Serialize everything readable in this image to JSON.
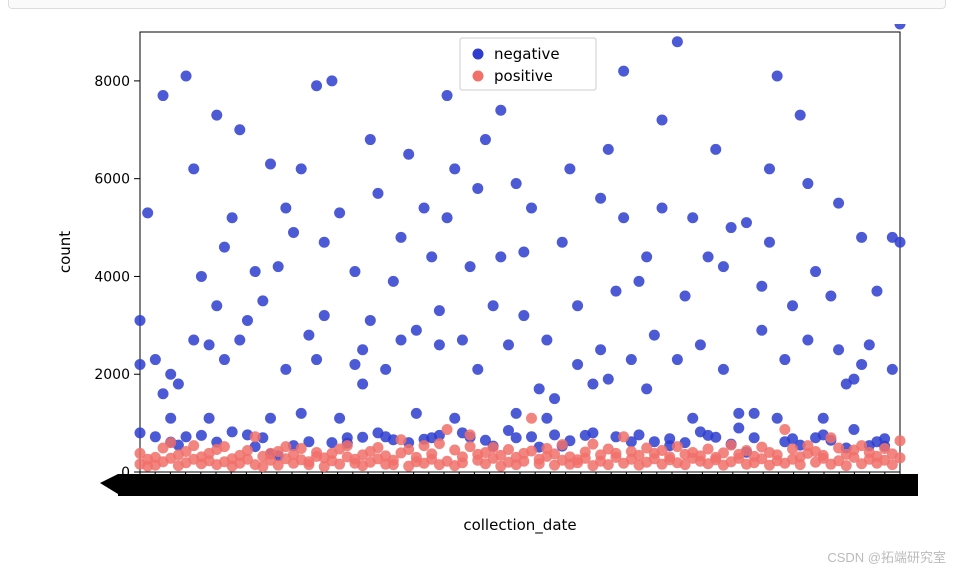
{
  "chart_data": {
    "type": "scatter",
    "title": "",
    "xlabel": "collection_date",
    "ylabel": "count",
    "ylim": [
      0,
      9000
    ],
    "yticks": [
      0,
      2000,
      4000,
      6000,
      8000
    ],
    "legend": [
      "negative",
      "positive"
    ],
    "legend_position": "upper center",
    "series": [
      {
        "name": "negative",
        "color": "#2e3dcf",
        "x": [
          1,
          1,
          1,
          2,
          2,
          3,
          3,
          4,
          4,
          5,
          5,
          5,
          6,
          6,
          7,
          7,
          8,
          8,
          9,
          9,
          10,
          10,
          11,
          11,
          11,
          12,
          12,
          13,
          13,
          14,
          14,
          15,
          15,
          16,
          16,
          17,
          17,
          18,
          18,
          18,
          19,
          19,
          20,
          20,
          21,
          21,
          22,
          22,
          23,
          23,
          24,
          24,
          25,
          25,
          26,
          26,
          27,
          27,
          28,
          28,
          29,
          29,
          30,
          30,
          30,
          31,
          31,
          32,
          32,
          33,
          33,
          34,
          34,
          35,
          35,
          36,
          36,
          37,
          37,
          38,
          38,
          39,
          39,
          40,
          40,
          40,
          41,
          41,
          42,
          42,
          43,
          43,
          44,
          44,
          45,
          45,
          46,
          46,
          47,
          47,
          48,
          48,
          49,
          49,
          50,
          50,
          50,
          51,
          51,
          52,
          52,
          53,
          53,
          54,
          54,
          55,
          55,
          56,
          56,
          57,
          57,
          58,
          58,
          59,
          60,
          60,
          61,
          61,
          62,
          62,
          63,
          63,
          64,
          64,
          65,
          65,
          66,
          66,
          67,
          67,
          68,
          68,
          69,
          69,
          70,
          70,
          71,
          71,
          72,
          72,
          73,
          73,
          74,
          74,
          75,
          75,
          76,
          76,
          77,
          77,
          78,
          78,
          79,
          79,
          80,
          80,
          81,
          81,
          82,
          82,
          83,
          83,
          84,
          84,
          85,
          85,
          86,
          86,
          87,
          87,
          88,
          88,
          89,
          89,
          90,
          90,
          91,
          91,
          92,
          92,
          93,
          93,
          94,
          94,
          95,
          95,
          96,
          96,
          97,
          97,
          98,
          98,
          99,
          99,
          100,
          100
        ],
        "y": [
          3100,
          800,
          2200,
          9400,
          5300,
          720,
          2300,
          7700,
          1600,
          610,
          2000,
          1100,
          550,
          1800,
          8100,
          720,
          2700,
          6200,
          4000,
          750,
          2600,
          1100,
          7300,
          3400,
          610,
          2300,
          4600,
          5200,
          820,
          7000,
          2700,
          3100,
          760,
          520,
          4100,
          3500,
          700,
          6300,
          1100,
          370,
          330,
          4200,
          5400,
          2100,
          540,
          4900,
          1200,
          6200,
          2800,
          620,
          2300,
          7900,
          3200,
          4700,
          600,
          8000,
          5300,
          1100,
          590,
          700,
          2200,
          4100,
          1800,
          710,
          2500,
          6800,
          3100,
          5700,
          800,
          720,
          2100,
          3900,
          660,
          4800,
          2700,
          6500,
          600,
          1200,
          2900,
          5400,
          670,
          700,
          4400,
          750,
          2600,
          3300,
          7700,
          5200,
          1100,
          6200,
          800,
          2700,
          710,
          4200,
          5800,
          2100,
          650,
          6800,
          3400,
          530,
          4400,
          7400,
          850,
          2600,
          1200,
          5900,
          700,
          4500,
          3200,
          720,
          5400,
          510,
          1700,
          2700,
          1100,
          760,
          1500,
          4700,
          530,
          640,
          6200,
          2200,
          3400,
          750,
          1800,
          800,
          2500,
          5600,
          1900,
          6600,
          720,
          3700,
          8200,
          5200,
          2300,
          620,
          3900,
          760,
          4400,
          1700,
          620,
          2800,
          7200,
          5400,
          540,
          680,
          2300,
          8800,
          3600,
          600,
          5200,
          1100,
          2600,
          820,
          4400,
          750,
          710,
          6600,
          2100,
          4200,
          570,
          5000,
          1200,
          900,
          5100,
          405,
          1200,
          700,
          2900,
          3800,
          6200,
          4700,
          8100,
          1100,
          2300,
          620,
          680,
          3400,
          7300,
          550,
          5900,
          2700,
          4100,
          700,
          1100,
          760,
          3600,
          650,
          2500,
          5500,
          490,
          1800,
          870,
          1900,
          2200,
          4800,
          540,
          2600,
          620,
          3700,
          530,
          680,
          4800,
          2100,
          4700
        ]
      },
      {
        "name": "positive",
        "color": "#f1706a",
        "x": [
          1,
          1,
          2,
          2,
          3,
          3,
          4,
          4,
          5,
          5,
          6,
          6,
          7,
          7,
          8,
          8,
          9,
          9,
          10,
          10,
          11,
          11,
          12,
          12,
          13,
          13,
          14,
          14,
          15,
          15,
          16,
          16,
          17,
          17,
          18,
          18,
          19,
          19,
          20,
          20,
          21,
          21,
          22,
          22,
          23,
          23,
          24,
          24,
          25,
          25,
          26,
          26,
          27,
          27,
          28,
          28,
          29,
          29,
          30,
          30,
          31,
          31,
          32,
          32,
          33,
          33,
          34,
          34,
          35,
          35,
          36,
          36,
          37,
          37,
          38,
          38,
          39,
          39,
          40,
          40,
          41,
          41,
          42,
          42,
          43,
          43,
          44,
          44,
          45,
          45,
          46,
          46,
          47,
          47,
          48,
          48,
          49,
          49,
          50,
          50,
          51,
          51,
          52,
          52,
          53,
          53,
          54,
          54,
          55,
          55,
          56,
          56,
          57,
          57,
          58,
          58,
          59,
          59,
          60,
          60,
          61,
          61,
          62,
          62,
          63,
          63,
          64,
          64,
          65,
          65,
          66,
          66,
          67,
          67,
          68,
          68,
          69,
          69,
          70,
          70,
          71,
          71,
          72,
          72,
          73,
          73,
          74,
          74,
          75,
          75,
          76,
          76,
          77,
          77,
          78,
          78,
          79,
          79,
          80,
          80,
          81,
          81,
          82,
          82,
          83,
          83,
          84,
          84,
          85,
          85,
          86,
          86,
          87,
          87,
          88,
          88,
          89,
          89,
          90,
          90,
          91,
          91,
          92,
          92,
          93,
          93,
          94,
          94,
          95,
          95,
          96,
          96,
          97,
          97,
          98,
          98,
          99,
          99,
          100,
          100
        ],
        "y": [
          160,
          380,
          120,
          260,
          300,
          140,
          490,
          210,
          280,
          600,
          130,
          350,
          190,
          420,
          260,
          540,
          170,
          310,
          380,
          230,
          150,
          460,
          520,
          210,
          270,
          120,
          340,
          180,
          440,
          260,
          720,
          150,
          110,
          320,
          380,
          240,
          420,
          140,
          520,
          270,
          180,
          360,
          250,
          480,
          150,
          210,
          320,
          400,
          110,
          290,
          380,
          230,
          470,
          160,
          540,
          310,
          180,
          260,
          350,
          130,
          200,
          420,
          270,
          500,
          160,
          330,
          240,
          150,
          660,
          390,
          120,
          460,
          210,
          300,
          180,
          540,
          260,
          370,
          150,
          580,
          220,
          870,
          450,
          130,
          310,
          190,
          760,
          520,
          240,
          360,
          170,
          400,
          280,
          500,
          120,
          340,
          200,
          460,
          150,
          300,
          380,
          220,
          1100,
          430,
          260,
          170,
          320,
          480,
          140,
          370,
          240,
          560,
          160,
          310,
          250,
          190,
          410,
          280,
          130,
          570,
          350,
          220,
          470,
          150,
          300,
          380,
          180,
          720,
          260,
          420,
          140,
          340,
          200,
          490,
          270,
          380,
          160,
          440,
          310,
          250,
          190,
          520,
          360,
          150,
          280,
          400,
          220,
          330,
          170,
          470,
          300,
          250,
          390,
          140,
          550,
          210,
          360,
          280,
          160,
          440,
          320,
          190,
          510,
          270,
          400,
          140,
          350,
          230,
          870,
          180,
          470,
          260,
          310,
          150,
          540,
          380,
          200,
          420,
          280,
          340,
          160,
          700,
          490,
          230,
          360,
          130,
          450,
          300,
          170,
          540,
          260,
          400,
          180,
          320,
          480,
          240,
          370,
          150,
          290,
          640
        ]
      }
    ],
    "x_categories_count": 50
  },
  "watermark": "CSDN @拓端研究室"
}
